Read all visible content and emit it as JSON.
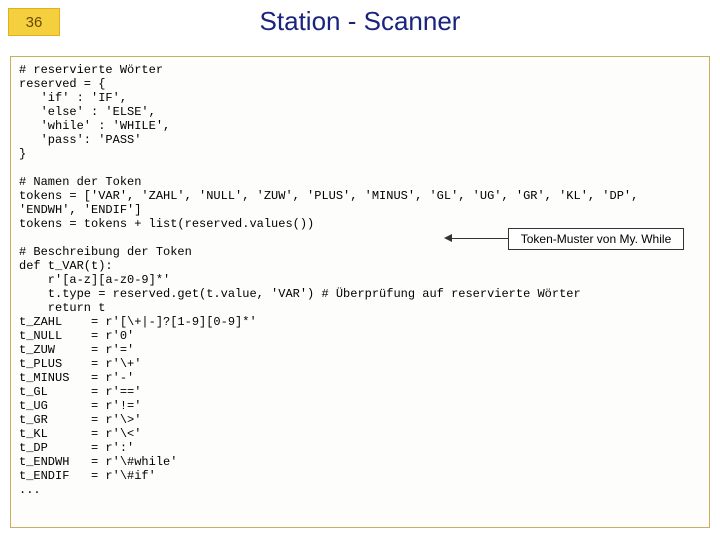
{
  "slide": {
    "page_number": "36",
    "title": "Station - Scanner"
  },
  "callout": {
    "text": "Token-Muster von My. While"
  },
  "code": {
    "text": "# reservierte Wörter\nreserved = {\n   'if' : 'IF',\n   'else' : 'ELSE',\n   'while' : 'WHILE',\n   'pass': 'PASS'\n}\n\n# Namen der Token\ntokens = ['VAR', 'ZAHL', 'NULL', 'ZUW', 'PLUS', 'MINUS', 'GL', 'UG', 'GR', 'KL', 'DP',\n'ENDWH', 'ENDIF']\ntokens = tokens + list(reserved.values())\n\n# Beschreibung der Token\ndef t_VAR(t):\n    r'[a-z][a-z0-9]*'\n    t.type = reserved.get(t.value, 'VAR') # Überprüfung auf reservierte Wörter\n    return t\nt_ZAHL    = r'[\\+|-]?[1-9][0-9]*'\nt_NULL    = r'0'\nt_ZUW     = r'='\nt_PLUS    = r'\\+'\nt_MINUS   = r'-'\nt_GL      = r'=='\nt_UG      = r'!='\nt_GR      = r'\\>'\nt_KL      = r'\\<'\nt_DP      = r':'\nt_ENDWH   = r'\\#while'\nt_ENDIF   = r'\\#if'\n..."
  }
}
